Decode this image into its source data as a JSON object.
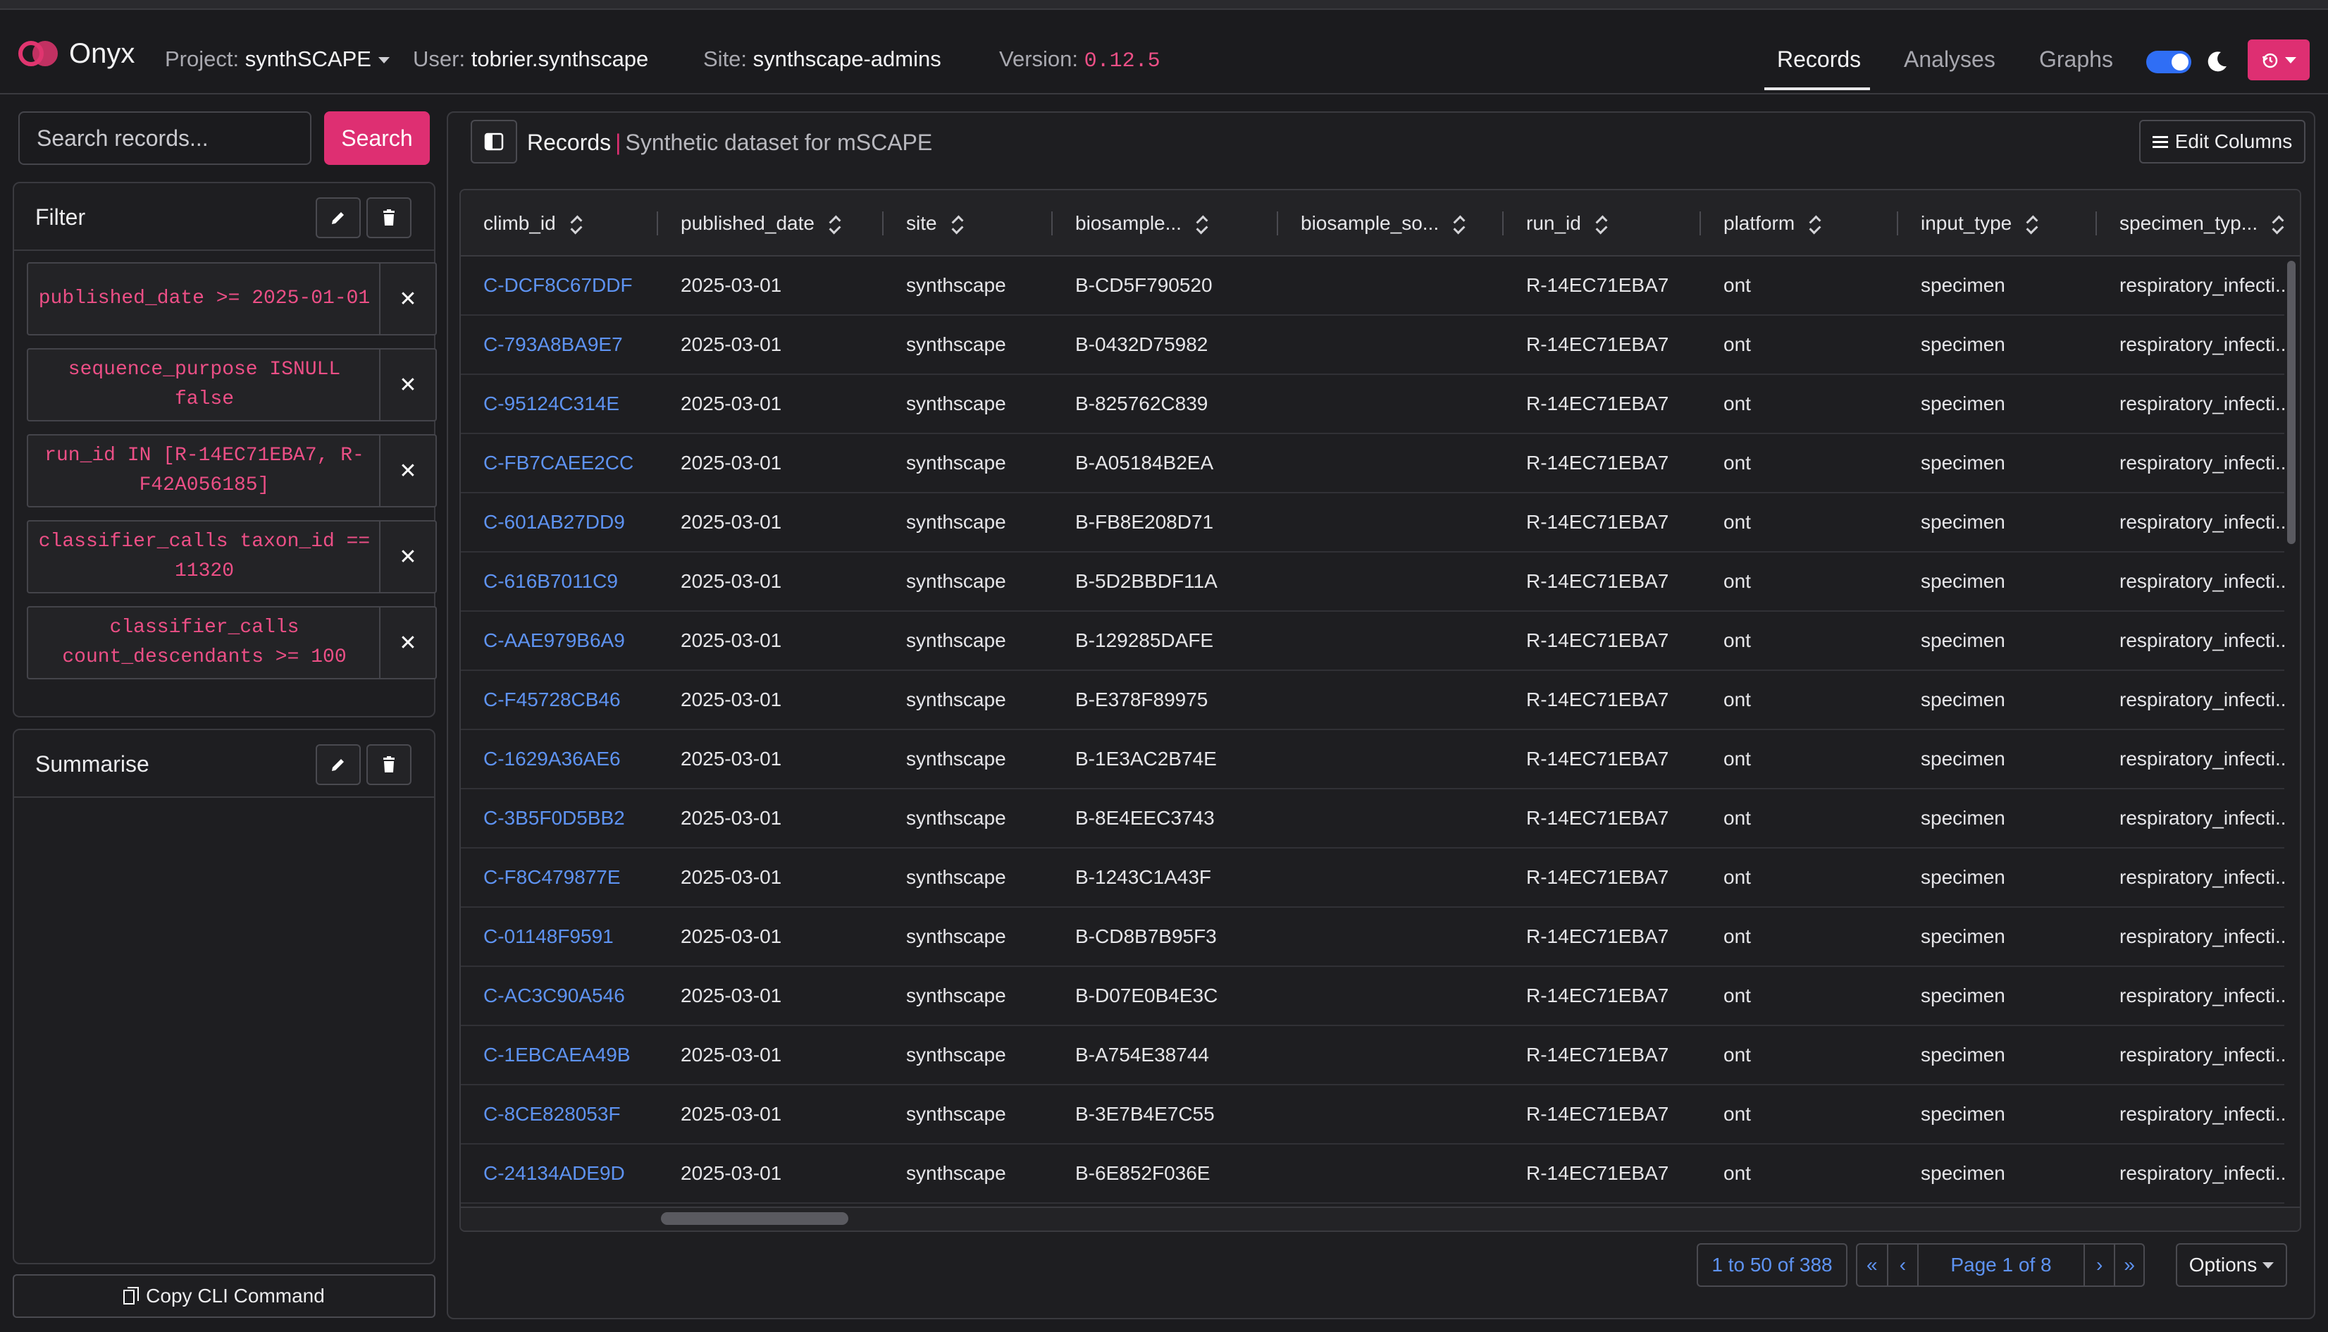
{
  "app": {
    "name": "Onyx"
  },
  "navbar": {
    "project_label": "Project:",
    "project_value": "synthSCAPE",
    "user_label": "User:",
    "user_value": "tobrier.synthscape",
    "site_label": "Site:",
    "site_value": "synthscape-admins",
    "version_label": "Version:",
    "version_value": "0.12.5",
    "links": [
      "Records",
      "Analyses",
      "Graphs"
    ],
    "active_link": "Records",
    "theme_toggle_on": true,
    "colors": {
      "accent": "#de2f72",
      "link": "#5e93f2",
      "toggle": "#2f6ef5"
    }
  },
  "search": {
    "placeholder": "Search records...",
    "button": "Search"
  },
  "filter": {
    "title": "Filter",
    "chips": [
      "published_date >= 2025-01-01",
      "sequence_purpose ISNULL false",
      "run_id IN [R-14EC71EBA7, R-F42A056185]",
      "classifier_calls taxon_id == 11320",
      "classifier_calls count_descendants >= 100"
    ]
  },
  "summarise": {
    "title": "Summarise"
  },
  "copy_cli": {
    "label": "Copy CLI Command"
  },
  "main": {
    "title": "Records",
    "subtitle": "Synthetic dataset for mSCAPE",
    "edit_columns": "Edit Columns"
  },
  "table": {
    "columns": [
      "climb_id",
      "published_date",
      "site",
      "biosample...",
      "biosample_so...",
      "run_id",
      "platform",
      "input_type",
      "specimen_typ..."
    ],
    "rows": [
      [
        "C-DCF8C67DDF",
        "2025-03-01",
        "synthscape",
        "B-CD5F790520",
        "",
        "R-14EC71EBA7",
        "ont",
        "specimen",
        "respiratory_infecti..."
      ],
      [
        "C-793A8BA9E7",
        "2025-03-01",
        "synthscape",
        "B-0432D75982",
        "",
        "R-14EC71EBA7",
        "ont",
        "specimen",
        "respiratory_infecti..."
      ],
      [
        "C-95124C314E",
        "2025-03-01",
        "synthscape",
        "B-825762C839",
        "",
        "R-14EC71EBA7",
        "ont",
        "specimen",
        "respiratory_infecti..."
      ],
      [
        "C-FB7CAEE2CC",
        "2025-03-01",
        "synthscape",
        "B-A05184B2EA",
        "",
        "R-14EC71EBA7",
        "ont",
        "specimen",
        "respiratory_infecti..."
      ],
      [
        "C-601AB27DD9",
        "2025-03-01",
        "synthscape",
        "B-FB8E208D71",
        "",
        "R-14EC71EBA7",
        "ont",
        "specimen",
        "respiratory_infecti..."
      ],
      [
        "C-616B7011C9",
        "2025-03-01",
        "synthscape",
        "B-5D2BBDF11A",
        "",
        "R-14EC71EBA7",
        "ont",
        "specimen",
        "respiratory_infecti..."
      ],
      [
        "C-AAE979B6A9",
        "2025-03-01",
        "synthscape",
        "B-129285DAFE",
        "",
        "R-14EC71EBA7",
        "ont",
        "specimen",
        "respiratory_infecti..."
      ],
      [
        "C-F45728CB46",
        "2025-03-01",
        "synthscape",
        "B-E378F89975",
        "",
        "R-14EC71EBA7",
        "ont",
        "specimen",
        "respiratory_infecti..."
      ],
      [
        "C-1629A36AE6",
        "2025-03-01",
        "synthscape",
        "B-1E3AC2B74E",
        "",
        "R-14EC71EBA7",
        "ont",
        "specimen",
        "respiratory_infecti..."
      ],
      [
        "C-3B5F0D5BB2",
        "2025-03-01",
        "synthscape",
        "B-8E4EEC3743",
        "",
        "R-14EC71EBA7",
        "ont",
        "specimen",
        "respiratory_infecti..."
      ],
      [
        "C-F8C479877E",
        "2025-03-01",
        "synthscape",
        "B-1243C1A43F",
        "",
        "R-14EC71EBA7",
        "ont",
        "specimen",
        "respiratory_infecti..."
      ],
      [
        "C-01148F9591",
        "2025-03-01",
        "synthscape",
        "B-CD8B7B95F3",
        "",
        "R-14EC71EBA7",
        "ont",
        "specimen",
        "respiratory_infecti..."
      ],
      [
        "C-AC3C90A546",
        "2025-03-01",
        "synthscape",
        "B-D07E0B4E3C",
        "",
        "R-14EC71EBA7",
        "ont",
        "specimen",
        "respiratory_infecti..."
      ],
      [
        "C-1EBCAEA49B",
        "2025-03-01",
        "synthscape",
        "B-A754E38744",
        "",
        "R-14EC71EBA7",
        "ont",
        "specimen",
        "respiratory_infecti..."
      ],
      [
        "C-8CE828053F",
        "2025-03-01",
        "synthscape",
        "B-3E7B4E7C55",
        "",
        "R-14EC71EBA7",
        "ont",
        "specimen",
        "respiratory_infecti..."
      ],
      [
        "C-24134ADE9D",
        "2025-03-01",
        "synthscape",
        "B-6E852F036E",
        "",
        "R-14EC71EBA7",
        "ont",
        "specimen",
        "respiratory_infecti..."
      ]
    ]
  },
  "pagination": {
    "count_text": "1 to 50 of 388",
    "first": "«",
    "prev": "‹",
    "page_text": "Page 1 of 8",
    "next": "›",
    "last": "»",
    "options": "Options"
  }
}
